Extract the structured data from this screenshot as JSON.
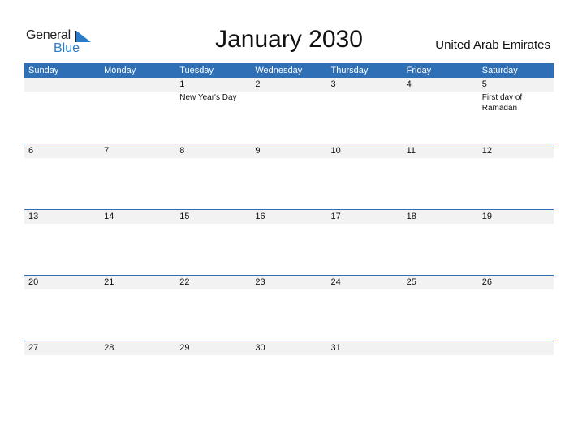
{
  "logo": {
    "word1": "General",
    "word2": "Blue"
  },
  "title": "January 2030",
  "country": "United Arab Emirates",
  "colors": {
    "header_bg": "#2e6fb5",
    "date_strip": "#f2f2f2",
    "logo_blue": "#2a7bc8"
  },
  "weekdays": [
    "Sunday",
    "Monday",
    "Tuesday",
    "Wednesday",
    "Thursday",
    "Friday",
    "Saturday"
  ],
  "weeks": [
    [
      {
        "day": ""
      },
      {
        "day": ""
      },
      {
        "day": "1",
        "event": "New Year's Day"
      },
      {
        "day": "2"
      },
      {
        "day": "3"
      },
      {
        "day": "4"
      },
      {
        "day": "5",
        "event": "First day of Ramadan"
      }
    ],
    [
      {
        "day": "6"
      },
      {
        "day": "7"
      },
      {
        "day": "8"
      },
      {
        "day": "9"
      },
      {
        "day": "10"
      },
      {
        "day": "11"
      },
      {
        "day": "12"
      }
    ],
    [
      {
        "day": "13"
      },
      {
        "day": "14"
      },
      {
        "day": "15"
      },
      {
        "day": "16"
      },
      {
        "day": "17"
      },
      {
        "day": "18"
      },
      {
        "day": "19"
      }
    ],
    [
      {
        "day": "20"
      },
      {
        "day": "21"
      },
      {
        "day": "22"
      },
      {
        "day": "23"
      },
      {
        "day": "24"
      },
      {
        "day": "25"
      },
      {
        "day": "26"
      }
    ],
    [
      {
        "day": "27"
      },
      {
        "day": "28"
      },
      {
        "day": "29"
      },
      {
        "day": "30"
      },
      {
        "day": "31"
      },
      {
        "day": ""
      },
      {
        "day": ""
      }
    ]
  ]
}
